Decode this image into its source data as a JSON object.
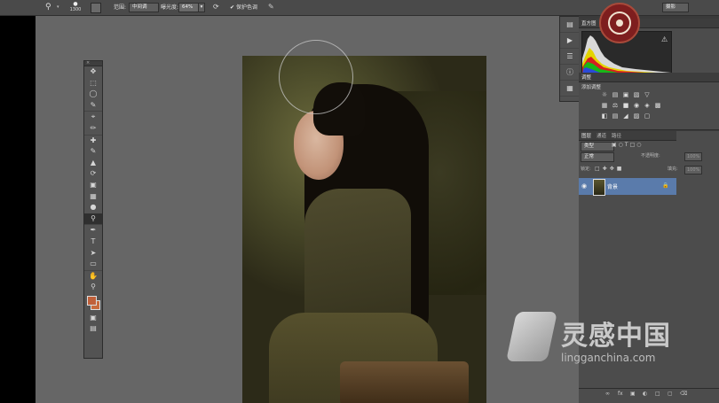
{
  "options_bar": {
    "tool_preset_icon": "zoom-icon",
    "brush_size": "1300",
    "range_label": "范围:",
    "range_value": "中间调",
    "exposure_label": "曝光度:",
    "exposure_value": "64%",
    "protect_tones_label": "保护色调",
    "protect_tones_checked": true,
    "workspace_value": "摄影"
  },
  "toolbox": {
    "tools": [
      "move-tool",
      "marquee-tool",
      "lasso-tool",
      "quick-select-tool",
      "crop-tool",
      "eyedropper-tool",
      "healing-brush-tool",
      "brush-tool",
      "clone-stamp-tool",
      "history-brush-tool",
      "eraser-tool",
      "gradient-tool",
      "blur-tool",
      "dodge-tool",
      "pen-tool",
      "type-tool",
      "path-select-tool",
      "rectangle-tool",
      "hand-tool",
      "zoom-tool"
    ],
    "active_tool": "dodge-tool",
    "foreground_color": "#c0603a",
    "background_color": "#c86a3c"
  },
  "panels": {
    "histogram_tab": "直方图",
    "adjustments_tab": "调整",
    "adjustments_subtitle": "添加调整",
    "layers_tabs": [
      "图层",
      "通道",
      "路径"
    ],
    "filter_kind": "类型",
    "blend_mode": "正常",
    "opacity_label": "不透明度:",
    "opacity_value": "100%",
    "lock_label": "锁定:",
    "fill_label": "填充:",
    "fill_value": "100%",
    "layer_name": "背景"
  },
  "watermark": {
    "cn": "灵感中国",
    "en": "lingganchina.com"
  },
  "colors": {
    "canvas_bg": "#666666",
    "selected_layer": "#5a7bab",
    "panel_bg": "#4c4c4c"
  }
}
